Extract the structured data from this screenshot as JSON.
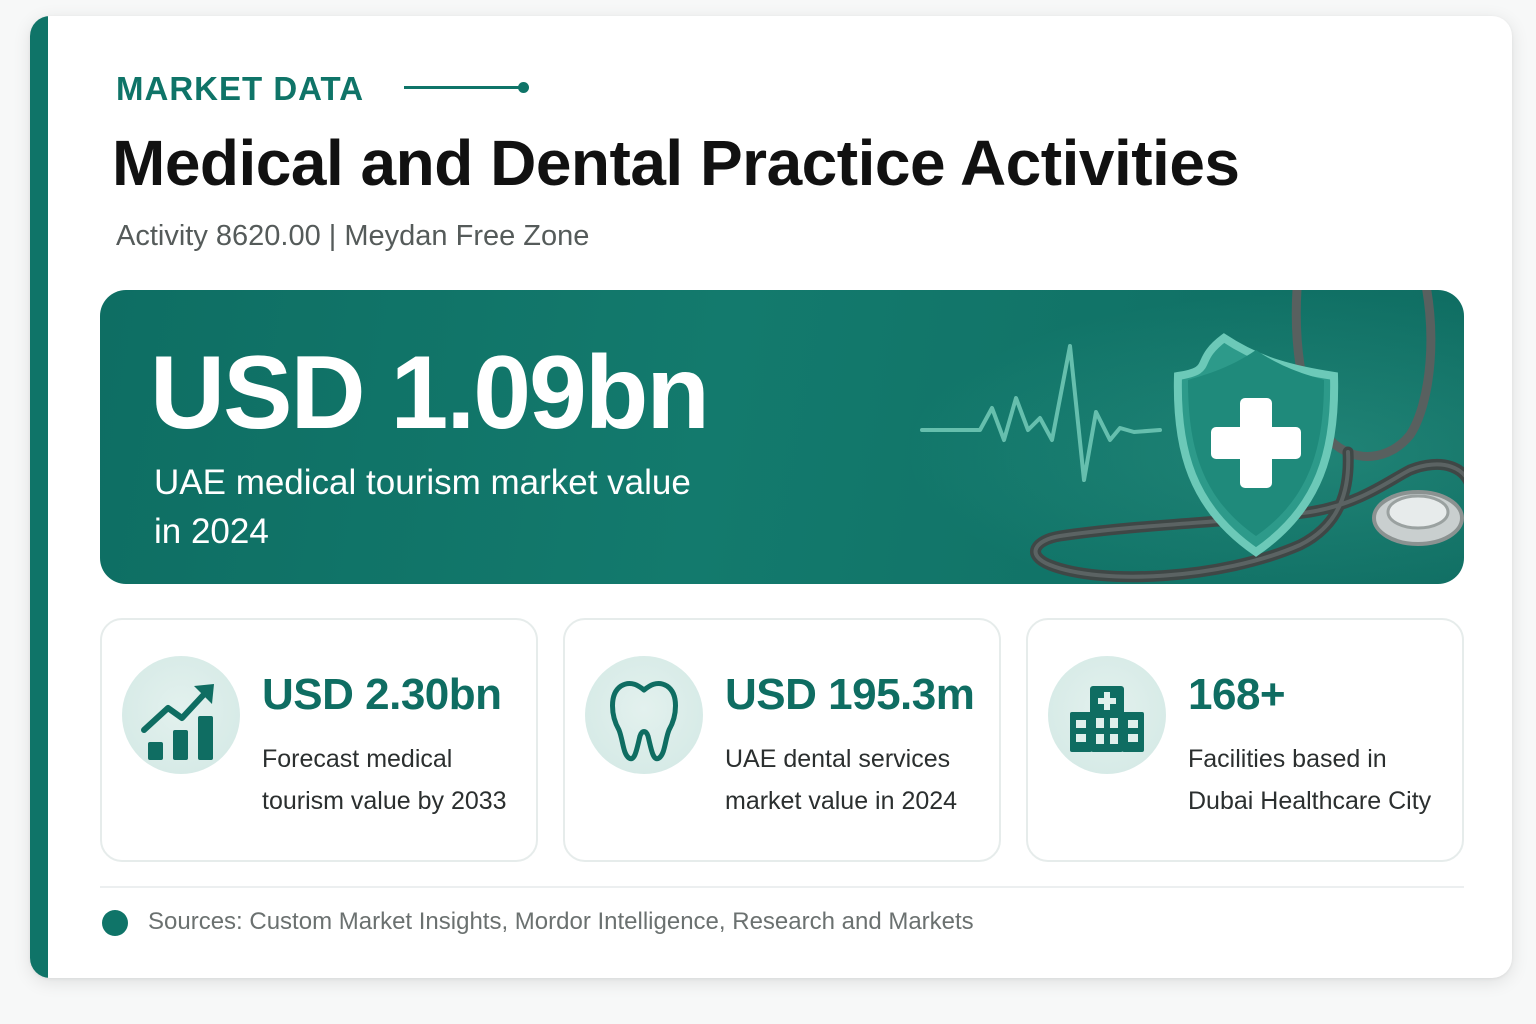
{
  "header": {
    "eyebrow": "MARKET DATA",
    "title": "Medical and Dental Practice Activities",
    "subtitle": "Activity 8620.00 | Meydan Free Zone"
  },
  "hero": {
    "value": "USD 1.09bn",
    "label": "UAE medical tourism market value in 2024",
    "icons": [
      "heartbeat-line",
      "shield-cross-icon",
      "stethoscope-icon"
    ]
  },
  "stats": [
    {
      "icon": "growth-chart-icon",
      "value": "USD 2.30bn",
      "description": "Forecast medical tourism value by 2033"
    },
    {
      "icon": "tooth-icon",
      "value": "USD 195.3m",
      "description": "UAE dental services market value in 2024"
    },
    {
      "icon": "hospital-icon",
      "value": "168+",
      "description": "Facilities based in Dubai Healthcare City"
    }
  ],
  "footer": {
    "sources": "Sources: Custom Market Insights, Mordor Intelligence, Research and Markets"
  },
  "colors": {
    "accent": "#0f7468",
    "hero_background": "#137a6d",
    "stat_value": "#0f6d62",
    "title": "#111111"
  }
}
